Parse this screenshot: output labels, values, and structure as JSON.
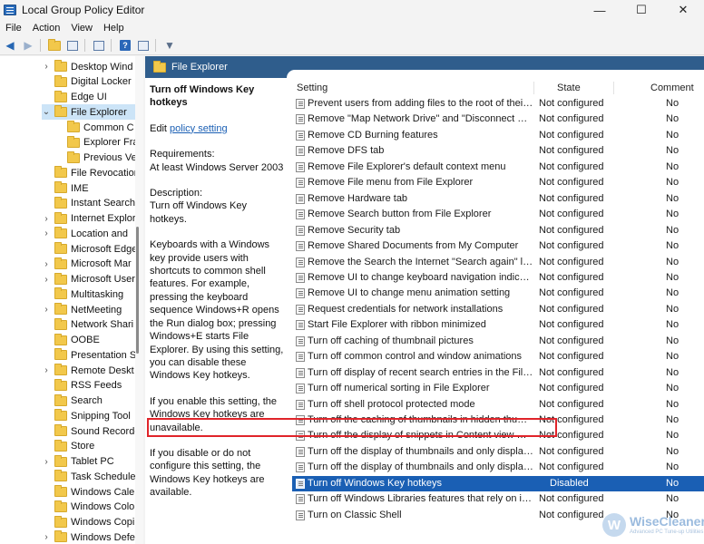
{
  "window": {
    "title": "Local Group Policy Editor",
    "minimize": "—",
    "maximize": "☐",
    "close": "✕"
  },
  "menu": [
    "File",
    "Action",
    "View",
    "Help"
  ],
  "toolbar": {
    "back": "◀",
    "forward": "▶"
  },
  "tree": [
    {
      "label": "Desktop Wind",
      "depth": 1,
      "expander": "›"
    },
    {
      "label": "Digital Locker",
      "depth": 1,
      "expander": ""
    },
    {
      "label": "Edge UI",
      "depth": 1,
      "expander": ""
    },
    {
      "label": "File Explorer",
      "depth": 1,
      "expander": "⌄",
      "selected": true
    },
    {
      "label": "Common C",
      "depth": 2,
      "expander": ""
    },
    {
      "label": "Explorer Fra",
      "depth": 2,
      "expander": ""
    },
    {
      "label": "Previous Ve",
      "depth": 2,
      "expander": ""
    },
    {
      "label": "File Revocation",
      "depth": 1,
      "expander": ""
    },
    {
      "label": "IME",
      "depth": 1,
      "expander": ""
    },
    {
      "label": "Instant Search",
      "depth": 1,
      "expander": ""
    },
    {
      "label": "Internet Explor",
      "depth": 1,
      "expander": "›"
    },
    {
      "label": "Location and",
      "depth": 1,
      "expander": "›"
    },
    {
      "label": "Microsoft Edge",
      "depth": 1,
      "expander": ""
    },
    {
      "label": "Microsoft Mar",
      "depth": 1,
      "expander": "›"
    },
    {
      "label": "Microsoft User",
      "depth": 1,
      "expander": "›"
    },
    {
      "label": "Multitasking",
      "depth": 1,
      "expander": ""
    },
    {
      "label": "NetMeeting",
      "depth": 1,
      "expander": "›"
    },
    {
      "label": "Network Shari",
      "depth": 1,
      "expander": ""
    },
    {
      "label": "OOBE",
      "depth": 1,
      "expander": ""
    },
    {
      "label": "Presentation S",
      "depth": 1,
      "expander": ""
    },
    {
      "label": "Remote Deskt",
      "depth": 1,
      "expander": "›"
    },
    {
      "label": "RSS Feeds",
      "depth": 1,
      "expander": ""
    },
    {
      "label": "Search",
      "depth": 1,
      "expander": ""
    },
    {
      "label": "Snipping Tool",
      "depth": 1,
      "expander": ""
    },
    {
      "label": "Sound Recorde",
      "depth": 1,
      "expander": ""
    },
    {
      "label": "Store",
      "depth": 1,
      "expander": ""
    },
    {
      "label": "Tablet PC",
      "depth": 1,
      "expander": "›"
    },
    {
      "label": "Task Scheduler",
      "depth": 1,
      "expander": ""
    },
    {
      "label": "Windows Caler",
      "depth": 1,
      "expander": ""
    },
    {
      "label": "Windows Colo",
      "depth": 1,
      "expander": ""
    },
    {
      "label": "Windows Copi",
      "depth": 1,
      "expander": ""
    },
    {
      "label": "Windows Defe",
      "depth": 1,
      "expander": "›"
    }
  ],
  "pane": {
    "title": "File Explorer",
    "description": {
      "heading": "Turn off Windows Key hotkeys",
      "edit_prefix": "Edit ",
      "edit_link": "policy setting",
      "requirements_label": "Requirements:",
      "requirements": "At least Windows Server 2003",
      "description_label": "Description:",
      "description": "Turn off Windows Key hotkeys.",
      "para1": "Keyboards with a Windows key provide users with shortcuts to common shell features. For example, pressing the keyboard sequence Windows+R opens the Run dialog box; pressing Windows+E starts File Explorer. By using this setting, you can disable these Windows Key hotkeys.",
      "para2": "If you enable this setting, the Windows Key hotkeys are unavailable.",
      "para3": "If you disable or do not configure this setting, the Windows Key hotkeys are available."
    },
    "columns": {
      "setting": "Setting",
      "state": "State",
      "comment": "Comment"
    },
    "rows": [
      {
        "setting": "Prevent users from adding files to the root of their Users Files folder.",
        "state": "Not configured",
        "comment": "No"
      },
      {
        "setting": "Remove \"Map Network Drive\" and \"Disconnect Network Drive\"",
        "state": "Not configured",
        "comment": "No"
      },
      {
        "setting": "Remove CD Burning features",
        "state": "Not configured",
        "comment": "No"
      },
      {
        "setting": "Remove DFS tab",
        "state": "Not configured",
        "comment": "No"
      },
      {
        "setting": "Remove File Explorer's default context menu",
        "state": "Not configured",
        "comment": "No"
      },
      {
        "setting": "Remove File menu from File Explorer",
        "state": "Not configured",
        "comment": "No"
      },
      {
        "setting": "Remove Hardware tab",
        "state": "Not configured",
        "comment": "No"
      },
      {
        "setting": "Remove Search button from File Explorer",
        "state": "Not configured",
        "comment": "No"
      },
      {
        "setting": "Remove Security tab",
        "state": "Not configured",
        "comment": "No"
      },
      {
        "setting": "Remove Shared Documents from My Computer",
        "state": "Not configured",
        "comment": "No"
      },
      {
        "setting": "Remove the Search the Internet \"Search again\" link",
        "state": "Not configured",
        "comment": "No"
      },
      {
        "setting": "Remove UI to change keyboard navigation indicator setting",
        "state": "Not configured",
        "comment": "No"
      },
      {
        "setting": "Remove UI to change menu animation setting",
        "state": "Not configured",
        "comment": "No"
      },
      {
        "setting": "Request credentials for network installations",
        "state": "Not configured",
        "comment": "No"
      },
      {
        "setting": "Start File Explorer with ribbon minimized",
        "state": "Not configured",
        "comment": "No"
      },
      {
        "setting": "Turn off caching of thumbnail pictures",
        "state": "Not configured",
        "comment": "No"
      },
      {
        "setting": "Turn off common control and window animations",
        "state": "Not configured",
        "comment": "No"
      },
      {
        "setting": "Turn off display of recent search entries in the File Explorer search box",
        "state": "Not configured",
        "comment": "No"
      },
      {
        "setting": "Turn off numerical sorting in File Explorer",
        "state": "Not configured",
        "comment": "No"
      },
      {
        "setting": "Turn off shell protocol protected mode",
        "state": "Not configured",
        "comment": "No"
      },
      {
        "setting": "Turn off the caching of thumbnails in hidden thumbs.db files",
        "state": "Not configured",
        "comment": "No"
      },
      {
        "setting": "Turn off the display of snippets in Content view mode",
        "state": "Not configured",
        "comment": "No"
      },
      {
        "setting": "Turn off the display of thumbnails and only display icons.",
        "state": "Not configured",
        "comment": "No"
      },
      {
        "setting": "Turn off the display of thumbnails and only display icons on network folders",
        "state": "Not configured",
        "comment": "No"
      },
      {
        "setting": "Turn off Windows Key hotkeys",
        "state": "Disabled",
        "comment": "No",
        "selected": true
      },
      {
        "setting": "Turn off Windows Libraries features that rely on indexed file data",
        "state": "Not configured",
        "comment": "No"
      },
      {
        "setting": "Turn on Classic Shell",
        "state": "Not configured",
        "comment": "No"
      }
    ]
  },
  "watermark": {
    "name": "WiseCleaner",
    "tagline": "Advanced PC Tune-up Utilities",
    "logo": "W"
  }
}
